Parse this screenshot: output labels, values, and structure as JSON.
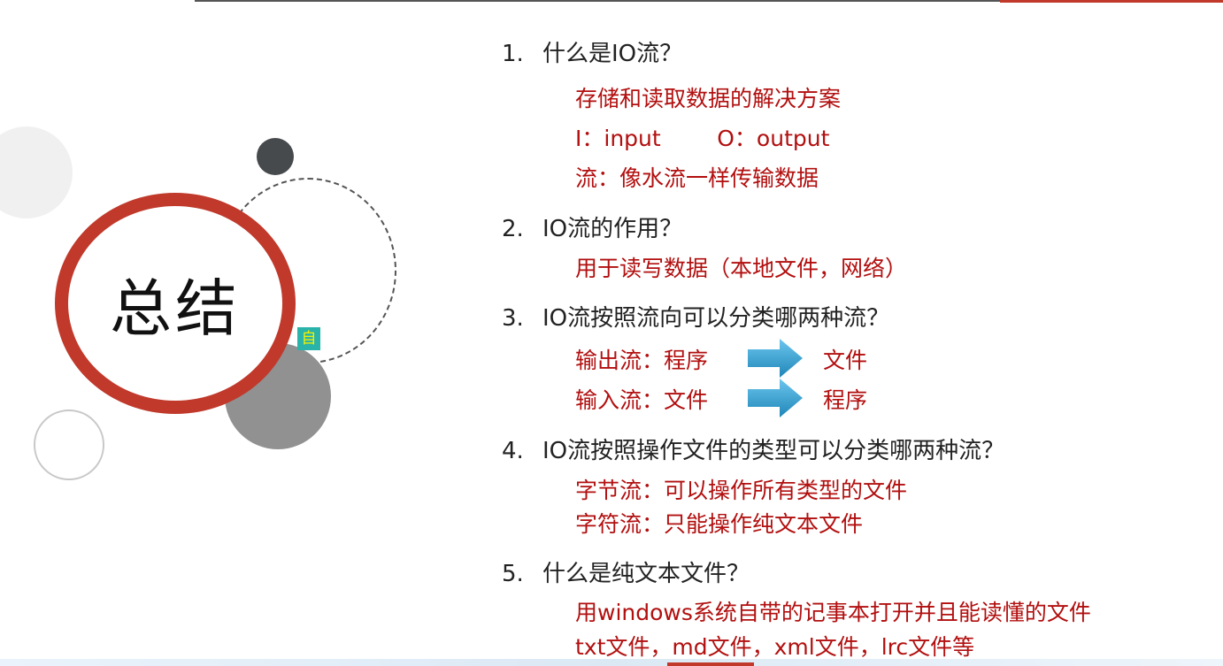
{
  "slide": {
    "title": "总结",
    "badge": "自"
  },
  "questions": [
    {
      "number": "1.",
      "text": "什么是IO流？",
      "answers": [
        "存储和读取数据的解决方案",
        "I：input        O：output",
        "流：像水流一样传输数据"
      ]
    },
    {
      "number": "2.",
      "text": "IO流的作用？",
      "answers": [
        "用于读写数据（本地文件，网络）"
      ]
    },
    {
      "number": "3.",
      "text": "IO流按照流向可以分类哪两种流？",
      "flows": [
        {
          "label": "输出流：程序",
          "target": "文件"
        },
        {
          "label": "输入流：文件",
          "target": "程序"
        }
      ]
    },
    {
      "number": "4.",
      "text": "IO流按照操作文件的类型可以分类哪两种流？",
      "answers": [
        "字节流：可以操作所有类型的文件",
        "字符流：只能操作纯文本文件"
      ]
    },
    {
      "number": "5.",
      "text": "什么是纯文本文件？",
      "answers": [
        "用windows系统自带的记事本打开并且能读懂的文件",
        "txt文件，md文件，xml文件，lrc文件等"
      ]
    }
  ],
  "colors": {
    "accent_red": "#c0392b",
    "answer_red": "#b20f0f",
    "arrow_blue": "#3aa7d8"
  }
}
